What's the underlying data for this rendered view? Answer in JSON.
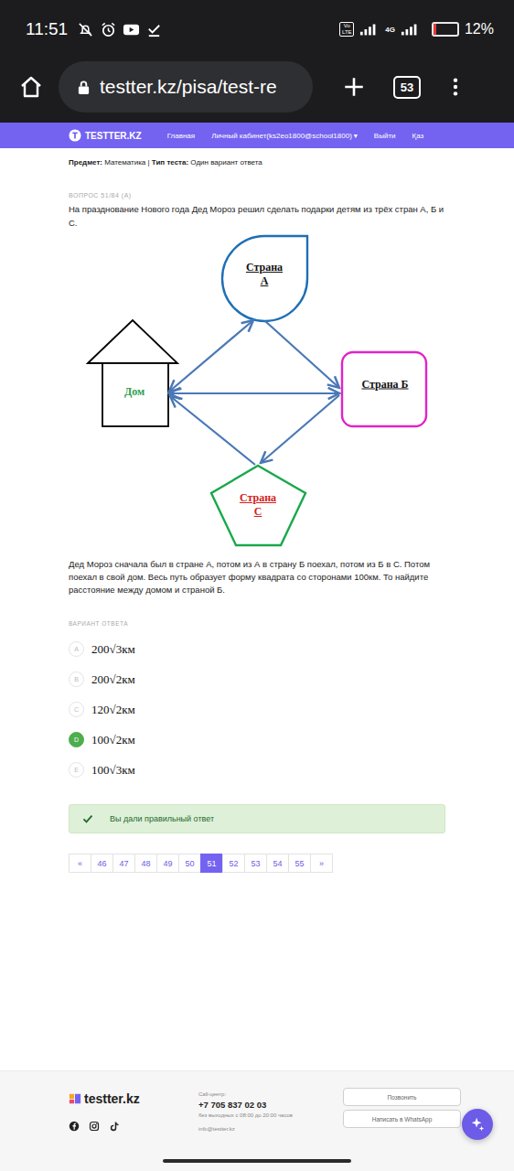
{
  "status_bar": {
    "time": "11:51",
    "volte": "Vo LTE",
    "network": "4G",
    "battery": "12%",
    "battery_level": 0.12
  },
  "browser": {
    "url": "testter.kz/pisa/test-re",
    "tab_count": "53"
  },
  "nav": {
    "logo": "TESTTER.KZ",
    "items": [
      {
        "label": "Главная",
        "caret": ""
      },
      {
        "label": "Личный кабинет(ks2eo1800@school1800)",
        "caret": "▾"
      },
      {
        "label": "Выйти",
        "caret": ""
      },
      {
        "label": "Қаз",
        "caret": ""
      }
    ]
  },
  "meta": {
    "subject_label": "Предмет:",
    "subject": "Математика",
    "separator": "|",
    "type_label": "Тип теста:",
    "type": "Один вариант ответа"
  },
  "question": {
    "number_label": "ВОПРОС 51/84 (A)",
    "text": "На празднование Нового года Дед Мороз решил сделать подарки детям из трёх стран А, Б и С.",
    "body": "Дед Мороз сначала был в стране А, потом из А в страну Б поехал, потом из Б в С. Потом поехал в свой дом. Весь путь образует форму квадрата со сторонами 100км. То найдите расстояние между домом и страной Б."
  },
  "diagram": {
    "nodes": [
      {
        "id": "home",
        "label": "Дом",
        "kind": "house",
        "color": "#000000",
        "label_color": "#2e9e4f"
      },
      {
        "id": "A",
        "label": "Страна А",
        "kind": "drop",
        "color": "#1f6fb5",
        "label_color": "#111111"
      },
      {
        "id": "B",
        "label": "Страна Б",
        "kind": "square",
        "color": "#e024c8",
        "label_color": "#111111"
      },
      {
        "id": "C",
        "label": "Страна С",
        "kind": "pentagon",
        "color": "#1aa84a",
        "label_color": "#d42020"
      }
    ]
  },
  "answers": {
    "heading": "ВАРИАНТ ОТВЕТА",
    "options": [
      {
        "letter": "A",
        "text": "200√3км",
        "selected": false
      },
      {
        "letter": "B",
        "text": "200√2км",
        "selected": false
      },
      {
        "letter": "C",
        "text": "120√2км",
        "selected": false
      },
      {
        "letter": "D",
        "text": "100√2км",
        "selected": true
      },
      {
        "letter": "E",
        "text": "100√3км",
        "selected": false
      }
    ]
  },
  "result": {
    "message": "Вы дали правильный ответ",
    "correct": true
  },
  "pagination": {
    "prev": "«",
    "next": "»",
    "pages": [
      {
        "label": "46",
        "selected": false
      },
      {
        "label": "47",
        "selected": false
      },
      {
        "label": "48",
        "selected": false
      },
      {
        "label": "49",
        "selected": false
      },
      {
        "label": "50",
        "selected": false
      },
      {
        "label": "51",
        "selected": true
      },
      {
        "label": "52",
        "selected": false
      },
      {
        "label": "53",
        "selected": false
      },
      {
        "label": "54",
        "selected": false
      },
      {
        "label": "55",
        "selected": false
      }
    ]
  },
  "footer": {
    "logo": "testter.kz",
    "call_label": "Call-центр:",
    "phone": "+7 705 837 02 03",
    "hours": "без выходных с 08:00 до 20:00 часов",
    "email": "info@testter.kz",
    "buttons": [
      "Позвонить",
      "Написать в WhatsApp"
    ]
  }
}
